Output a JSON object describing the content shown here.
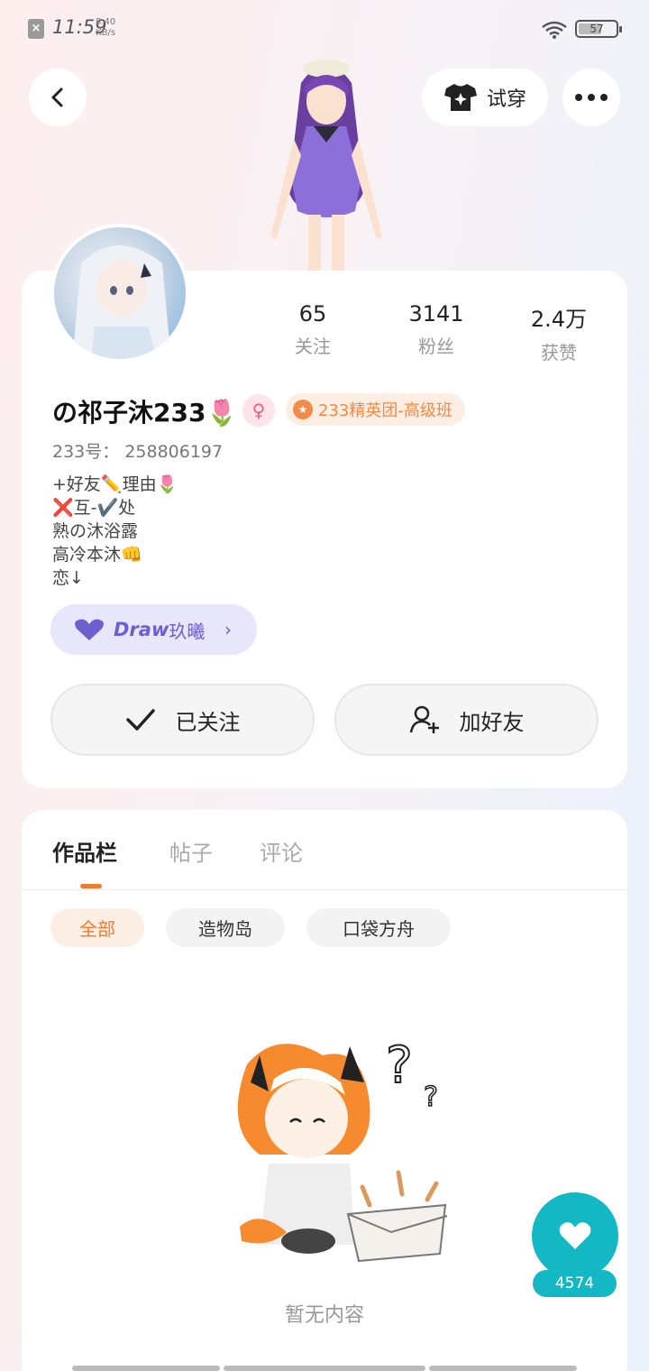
{
  "status_bar": {
    "time": "11:59",
    "net_speed_value": "8.40",
    "net_speed_unit": "KB/s",
    "battery": "57"
  },
  "header": {
    "tryon_label": "试穿"
  },
  "profile": {
    "stats": [
      {
        "value": "65",
        "label": "关注"
      },
      {
        "value": "3141",
        "label": "粉丝"
      },
      {
        "value": "2.4万",
        "label": "获赞"
      }
    ],
    "username": "の祁子沐233🌷",
    "group_badge": "233精英团-高级班",
    "uid": "233号： 258806197",
    "bio": "+好友✏️理由🌷\n❌互-✔️处\n熟の沐浴露\n高冷本沐👊\n恋↓",
    "draw_chip_brand": "Draw",
    "draw_chip_name": "玖曦",
    "follow_label": "已关注",
    "add_friend_label": "加好友"
  },
  "tabs": [
    {
      "label": "作品栏",
      "active": true
    },
    {
      "label": "帖子",
      "active": false
    },
    {
      "label": "评论",
      "active": false
    }
  ],
  "filters": [
    {
      "label": "全部",
      "active": true
    },
    {
      "label": "造物岛",
      "active": false
    },
    {
      "label": "口袋方舟",
      "active": false
    }
  ],
  "empty_state": "暂无内容",
  "like_count": "4574",
  "colors": {
    "accent_orange": "#f07a2e",
    "teal": "#14b8c4",
    "draw_purple": "#6c5fd0"
  }
}
